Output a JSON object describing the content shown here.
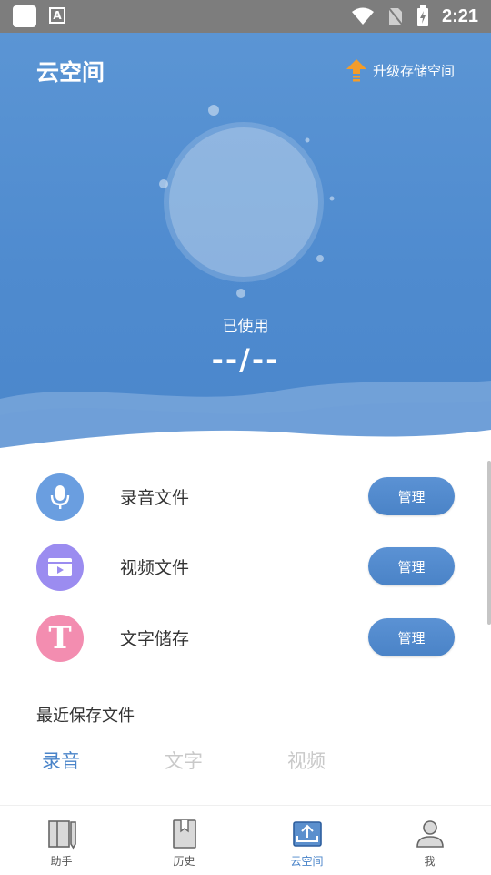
{
  "status_bar": {
    "time": "2:21",
    "a_icon": "A"
  },
  "header": {
    "title": "云空间",
    "upgrade_label": "升级存储空间"
  },
  "usage": {
    "label": "已使用",
    "value": "--/--"
  },
  "storage_rows": [
    {
      "label": "录音文件",
      "icon": "microphone-icon",
      "color": "#6a9ee0",
      "action": "管理"
    },
    {
      "label": "视频文件",
      "icon": "video-icon",
      "color": "#9b8cf0",
      "action": "管理"
    },
    {
      "label": "文字储存",
      "icon": "text-t-icon",
      "color": "#f38db0",
      "icon_text": "T",
      "action": "管理"
    }
  ],
  "recent": {
    "title": "最近保存文件",
    "tabs": [
      {
        "label": "录音",
        "active": true
      },
      {
        "label": "文字",
        "active": false
      },
      {
        "label": "视频",
        "active": false
      }
    ]
  },
  "bottom_nav": [
    {
      "label": "助手",
      "icon": "book-pen-icon"
    },
    {
      "label": "历史",
      "icon": "bookmark-book-icon"
    },
    {
      "label": "云空间",
      "icon": "cloud-upload-icon",
      "active": true
    },
    {
      "label": "我",
      "icon": "person-icon"
    }
  ],
  "colors": {
    "primary": "#4a84c9",
    "hero_top": "#5b95d4",
    "accent_orange": "#f39c2a"
  }
}
